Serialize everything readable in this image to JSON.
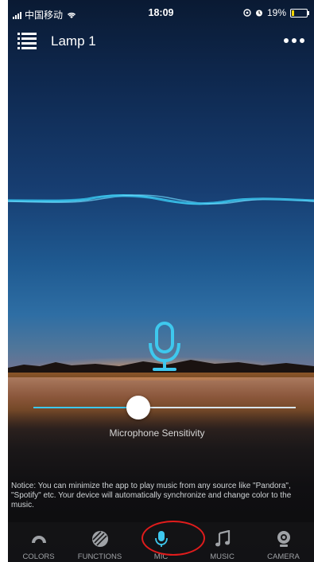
{
  "status_bar": {
    "carrier": "中国移动",
    "time": "18:09",
    "battery": "19%",
    "battery_level": 0.19
  },
  "nav": {
    "title": "Lamp 1"
  },
  "mic": {
    "sensitivity_label": "Microphone Sensitivity",
    "sensitivity_value": 0.4
  },
  "notice": "Notice: You can minimize the app to play music from any source like \"Pandora\", \"Spotify\" etc. Your device will automatically synchronize and change color to the music.",
  "tabs": [
    {
      "label": "COLORS",
      "icon": "colors-icon"
    },
    {
      "label": "FUNCTIONS",
      "icon": "functions-icon"
    },
    {
      "label": "MIC",
      "icon": "mic-icon"
    },
    {
      "label": "MUSIC",
      "icon": "music-note-icon"
    },
    {
      "label": "CAMERA",
      "icon": "camera-icon"
    }
  ],
  "colors": {
    "accent": "#3ec8ee",
    "highlight_ring": "#e01c1c"
  }
}
